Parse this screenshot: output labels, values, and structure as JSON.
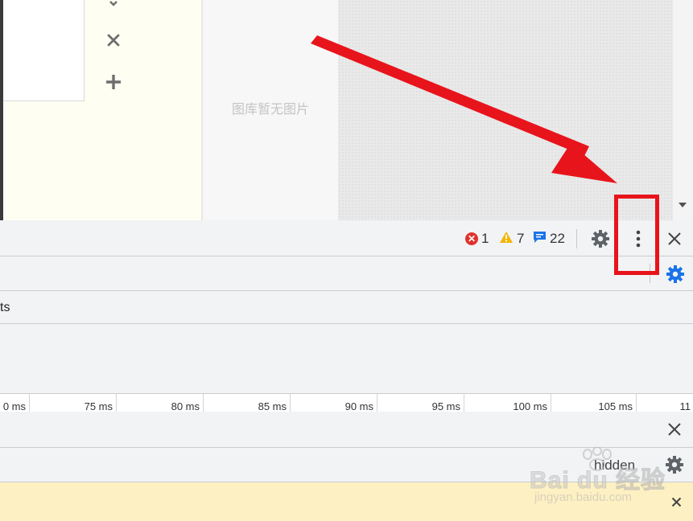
{
  "page": {
    "gallery_empty_text": "图库暂无图片"
  },
  "devtools": {
    "toolbar": {
      "errors_count": "1",
      "warnings_count": "7",
      "messages_count": "22"
    },
    "row3_text": "ts",
    "timeline": {
      "ticks": [
        "0 ms",
        "75 ms",
        "80 ms",
        "85 ms",
        "90 ms",
        "95 ms",
        "100 ms",
        "105 ms",
        "11"
      ]
    },
    "hidden_label": "hidden"
  },
  "watermark": {
    "brand": "Bai du 经验",
    "url": "jingyan.baidu.com"
  },
  "colors": {
    "annotation_red": "#e8141c",
    "error_red": "#e0322d",
    "warning_yellow": "#f4b400",
    "info_blue": "#1a73e8",
    "warning_bar": "#fdf0c2"
  }
}
